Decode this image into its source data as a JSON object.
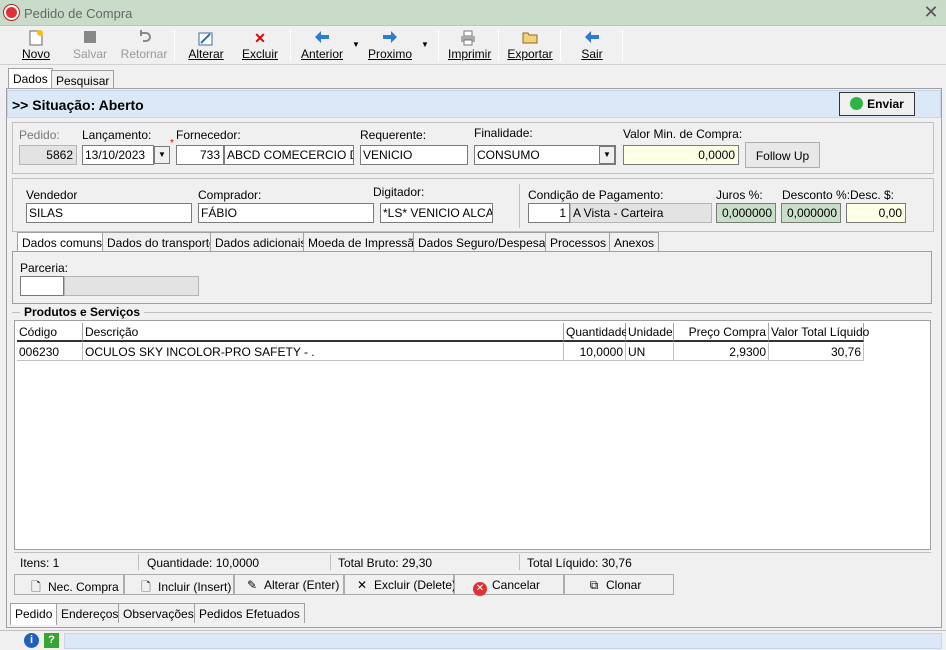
{
  "window": {
    "title": "Pedido de Compra",
    "close": "✕"
  },
  "toolbar": {
    "novo": "Novo",
    "salvar": "Salvar",
    "retornar": "Retornar",
    "alterar": "Alterar",
    "excluir": "Excluir",
    "anterior": "Anterior",
    "proximo": "Proximo",
    "imprimir": "Imprimir",
    "exportar": "Exportar",
    "sair": "Sair"
  },
  "top_tabs": [
    "Dados",
    "Pesquisar"
  ],
  "situacao": "&gt;&gt; Situação: Aberto",
  "enviar": "Enviar",
  "header": {
    "pedido_label": "Pedido:",
    "pedido": "5862",
    "lancamento_label": "Lançamento:",
    "lancamento": "13/10/2023",
    "fornecedor_label": "Fornecedor:",
    "fornecedor_code": "733",
    "fornecedor_name": "ABCD COMECERCIO DE E",
    "requerente_label": "Requerente:",
    "requerente": "VENICIO",
    "finalidade_label": "Finalidade:",
    "finalidade": "CONSUMO",
    "valor_min_label": "Valor Min. de Compra:",
    "valor_min": "0,0000",
    "follow_up": "Follow Up"
  },
  "details": {
    "vendedor_label": "Vendedor",
    "vendedor": "SILAS",
    "comprador_label": "Comprador:",
    "comprador": "FÁBIO",
    "digitador_label": "Digitador:",
    "digitador": "*LS* VENICIO ALCALD",
    "cond_label": "Condição de Pagamento:",
    "cond_code": "1",
    "cond_name": "A Vista - Carteira",
    "juros_label": "Juros %:",
    "juros": "0,000000",
    "desconto_label": "Desconto %:",
    "desconto": "0,000000",
    "desc_label": "Desc. $:",
    "desc": "0,00"
  },
  "sub_tabs": [
    "Dados comuns",
    "Dados do transporte",
    "Dados adicionais",
    "Moeda de Impressão",
    "Dados Seguro/Despesas",
    "Processos",
    "Anexos"
  ],
  "parceria_label": "Parceria:",
  "products": {
    "title": "Produtos e Serviços",
    "columns": [
      "Código",
      "Descrição",
      "Quantidade",
      "Unidade",
      "Preço Compra",
      "Valor Total Líquido"
    ],
    "rows": [
      [
        "006230",
        "OCULOS SKY INCOLOR-PRO SAFETY - .",
        "10,0000",
        "UN",
        "2,9300",
        "30,76"
      ]
    ]
  },
  "summary": {
    "itens": "Itens: 1",
    "quantidade": "Quantidade: 10,0000",
    "bruto": "Total Bruto: 29,30",
    "liquido": "Total Líquido: 30,76"
  },
  "actions": {
    "nec": "Nec. Compra",
    "incluir": "Incluir (Insert)",
    "alterar": "Alterar (Enter)",
    "excluir": "Excluir (Delete)",
    "cancelar": "Cancelar",
    "clonar": "Clonar"
  },
  "bottom_tabs": [
    "Pedido",
    "Endereços",
    "Observações",
    "Pedidos Efetuados"
  ],
  "footer": {
    "info": "i",
    "help": "?"
  }
}
